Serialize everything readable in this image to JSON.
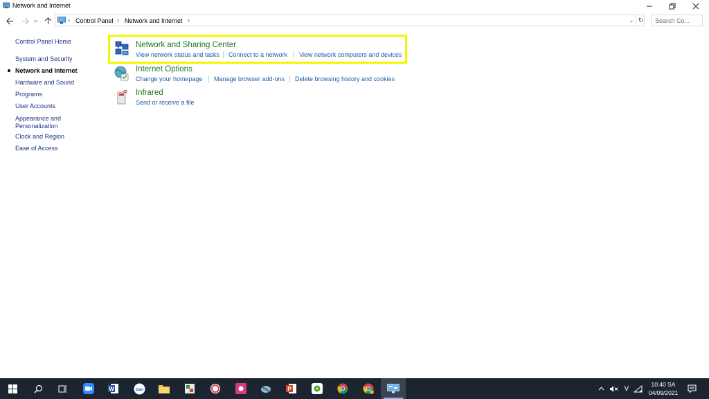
{
  "window": {
    "title": "Network and Internet",
    "controls": {
      "minimize": "minimize-icon",
      "maximize": "restore-icon",
      "close": "close-icon"
    }
  },
  "address_bar": {
    "breadcrumbs": [
      "Control Panel",
      "Network and Internet"
    ],
    "search_placeholder": "Search Co..."
  },
  "left_nav": {
    "items": [
      {
        "label": "Control Panel Home",
        "current": false
      },
      {
        "label": "System and Security",
        "current": false
      },
      {
        "label": "Network and Internet",
        "current": true
      },
      {
        "label": "Hardware and Sound",
        "current": false
      },
      {
        "label": "Programs",
        "current": false
      },
      {
        "label": "User Accounts",
        "current": false
      },
      {
        "label": "Appearance and",
        "current": false
      },
      {
        "label": "Personalization",
        "current": false
      },
      {
        "label": "Clock and Region",
        "current": false
      },
      {
        "label": "Ease of Access",
        "current": false
      }
    ]
  },
  "categories": [
    {
      "title": "Network and Sharing Center",
      "icon": "network-sharing-icon",
      "tasks": [
        "View network status and tasks",
        "Connect to a network",
        "View network computers and devices"
      ]
    },
    {
      "title": "Internet Options",
      "icon": "internet-options-icon",
      "tasks": [
        "Change your homepage",
        "Manage browser add-ons",
        "Delete browsing history and cookies"
      ]
    },
    {
      "title": "Infrared",
      "icon": "infrared-icon",
      "tasks": [
        "Send or receive a file"
      ]
    }
  ],
  "taskbar": {
    "apps": [
      "start-icon",
      "search-icon",
      "task-view-icon",
      "zoom-icon",
      "word-icon",
      "zalo-icon",
      "file-explorer-icon",
      "app-icon",
      "app-icon",
      "app-icon",
      "app-icon",
      "powerpoint-icon",
      "app-icon",
      "chrome-icon",
      "chrome-icon",
      "control-panel-icon"
    ],
    "tray": {
      "ime": "V"
    },
    "clock": {
      "time": "10:40 SA",
      "date": "04/09/2021"
    }
  },
  "colors": {
    "highlight": "#f5f500",
    "category_title": "#1e7a1e",
    "link": "#1e5ba8",
    "taskbar": "#1b2430"
  }
}
